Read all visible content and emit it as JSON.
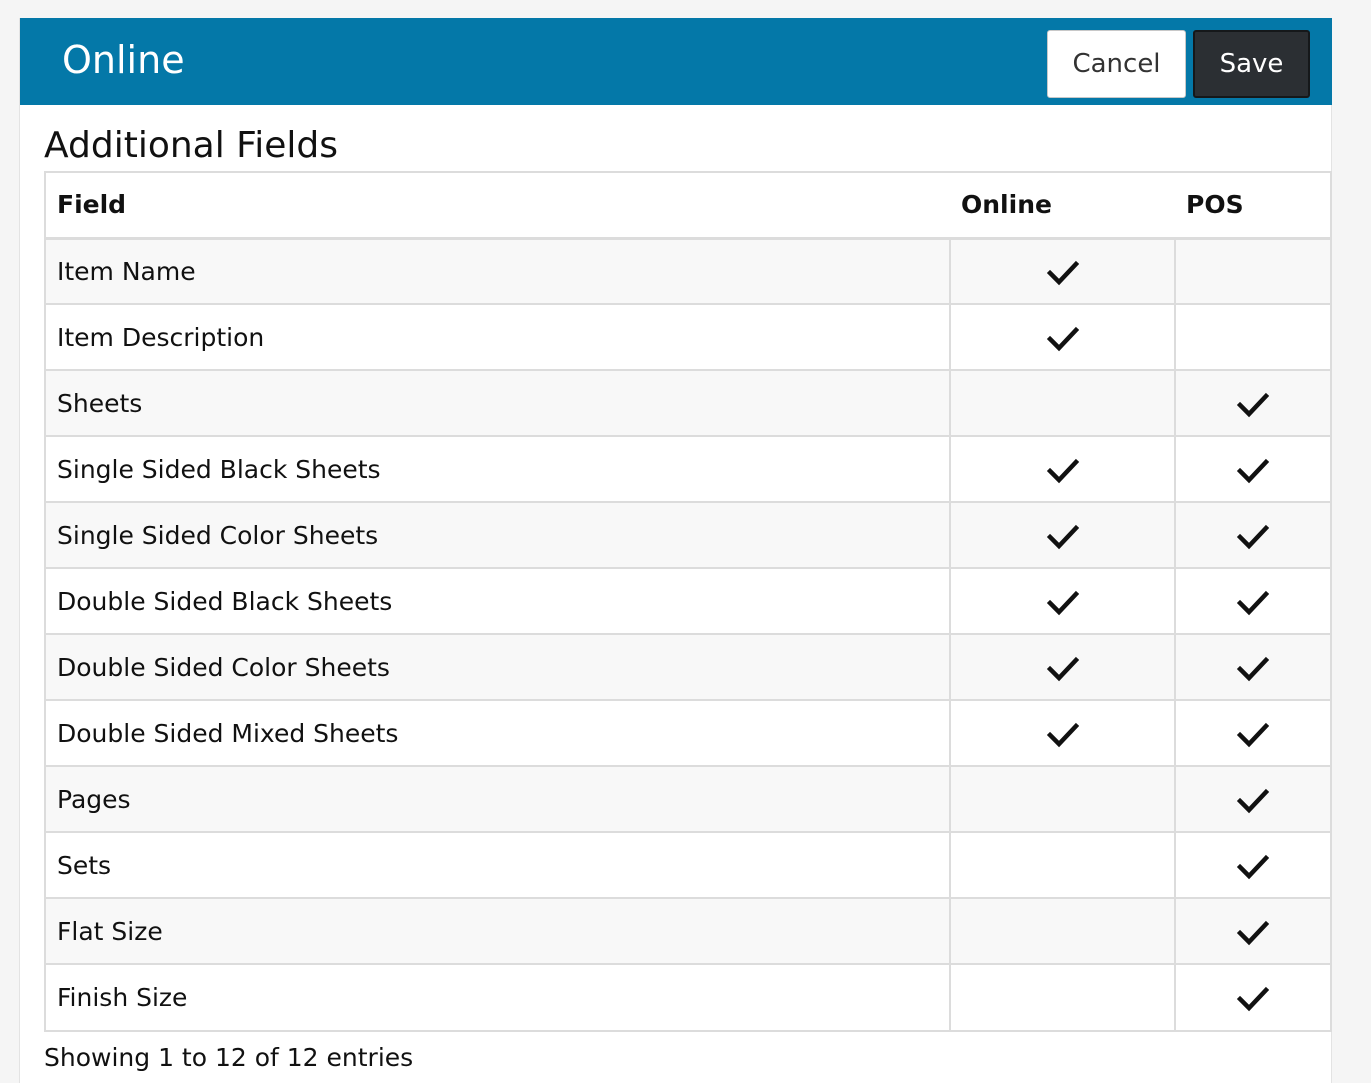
{
  "header": {
    "title": "Online",
    "cancel_label": "Cancel",
    "save_label": "Save",
    "background_color": "#0478a8"
  },
  "section": {
    "title": "Additional Fields"
  },
  "table": {
    "columns": [
      "Field",
      "Online",
      "POS"
    ],
    "rows": [
      {
        "field": "Item Name",
        "online": true,
        "pos": false
      },
      {
        "field": "Item Description",
        "online": true,
        "pos": false
      },
      {
        "field": "Sheets",
        "online": false,
        "pos": true
      },
      {
        "field": "Single Sided Black Sheets",
        "online": true,
        "pos": true
      },
      {
        "field": "Single Sided Color Sheets",
        "online": true,
        "pos": true
      },
      {
        "field": "Double Sided Black Sheets",
        "online": true,
        "pos": true
      },
      {
        "field": "Double Sided Color Sheets",
        "online": true,
        "pos": true
      },
      {
        "field": "Double Sided Mixed Sheets",
        "online": true,
        "pos": true
      },
      {
        "field": "Pages",
        "online": false,
        "pos": true
      },
      {
        "field": "Sets",
        "online": false,
        "pos": true
      },
      {
        "field": "Flat Size",
        "online": false,
        "pos": true
      },
      {
        "field": "Finish Size",
        "online": false,
        "pos": true
      }
    ],
    "check_icon": "check-icon"
  },
  "footer": {
    "info": "Showing 1 to 12 of 12 entries"
  }
}
